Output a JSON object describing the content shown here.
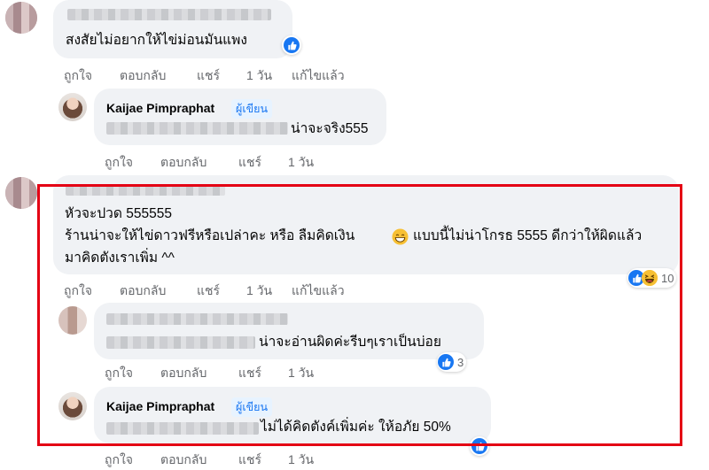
{
  "comments": [
    {
      "text": "สงสัยไม่อยากให้ไข่ม่อนมันแพง",
      "actions": {
        "like": "ถูกใจ",
        "reply": "ตอบกลับ",
        "share": "แชร์",
        "time": "1 วัน",
        "edited": "แก้ไขแล้ว"
      }
    },
    {
      "name": "Kaijae Pimpraphat",
      "badge": "ผู้เขียน",
      "text": "น่าจะจริง555",
      "actions": {
        "like": "ถูกใจ",
        "reply": "ตอบกลับ",
        "share": "แชร์",
        "time": "1 วัน"
      }
    },
    {
      "line1": "หัวจะปวด 555555",
      "line2a": "ร้านน่าจะให้ไข่ดาวฟรีหรือเปล่าคะ หรือ ลืมคิดเงิน",
      "line2b": "แบบนี้ไม่น่าโกรธ 5555 ดีกว่าให้ผิดแล้ว",
      "line3": "มาคิดตังเราเพิ่ม ^^",
      "reactions": {
        "icons": [
          "like-icon",
          "haha-icon"
        ],
        "count": "10"
      },
      "actions": {
        "like": "ถูกใจ",
        "reply": "ตอบกลับ",
        "share": "แชร์",
        "time": "1 วัน",
        "edited": "แก้ไขแล้ว"
      }
    },
    {
      "text": "น่าจะอ่านผิดค่ะรีบๆเราเป็นบ่อย",
      "reactions": {
        "icons": [
          "like-icon"
        ],
        "count": "3"
      },
      "actions": {
        "like": "ถูกใจ",
        "reply": "ตอบกลับ",
        "share": "แชร์",
        "time": "1 วัน"
      }
    },
    {
      "name": "Kaijae Pimpraphat",
      "badge": "ผู้เขียน",
      "text": "ไม่ได้คิดตังค์เพิ่มค่ะ ให้อภัย 50%",
      "reactions": {
        "icons": [
          "like-icon"
        ]
      },
      "actions": {
        "like": "ถูกใจ",
        "reply": "ตอบกลับ",
        "share": "แชร์",
        "time": "1 วัน"
      }
    }
  ],
  "colors": {
    "highlight": "#e40014",
    "like": "#1877f2",
    "bubble": "#f0f2f5",
    "badge_text": "#1876f2"
  }
}
